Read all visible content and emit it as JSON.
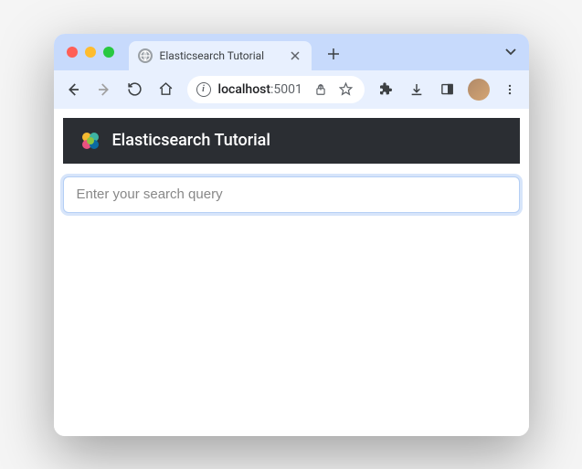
{
  "tab": {
    "title": "Elasticsearch Tutorial"
  },
  "address": {
    "host": "localhost",
    "port": ":5001"
  },
  "app": {
    "header_title": "Elasticsearch Tutorial"
  },
  "search": {
    "placeholder": "Enter your search query",
    "value": ""
  }
}
